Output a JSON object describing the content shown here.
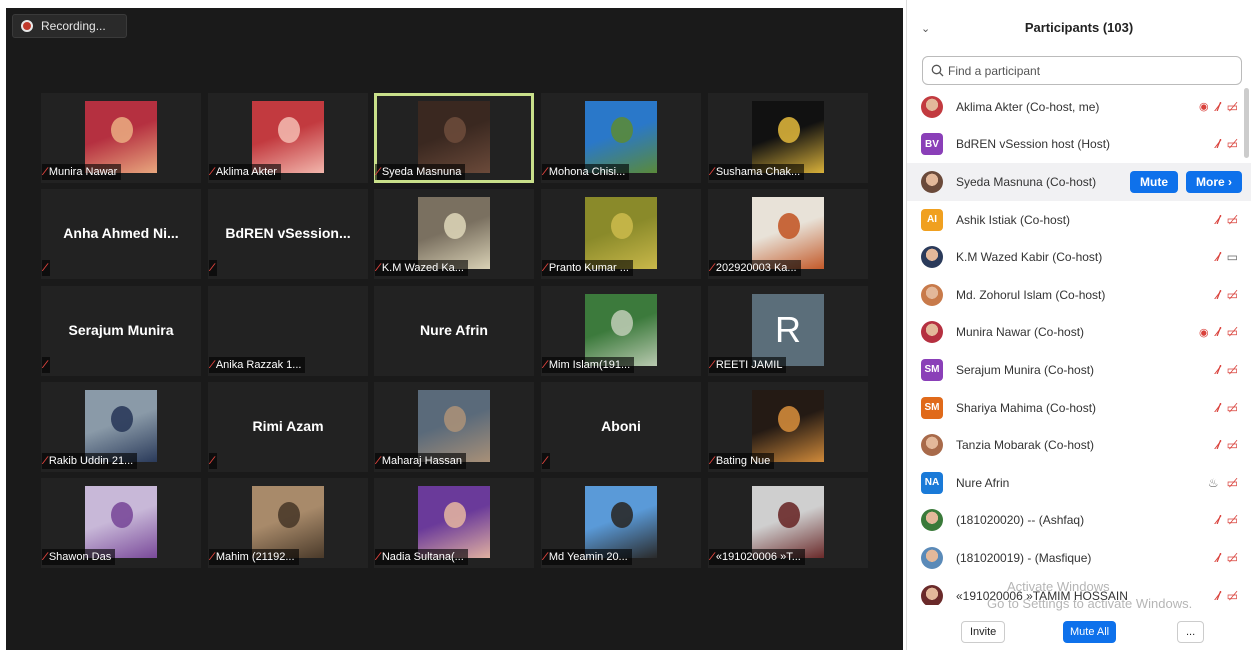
{
  "recording": {
    "label": "Recording...",
    "icon": "record-dot-icon"
  },
  "gallery": [
    {
      "name": "Munira Nawar",
      "type": "photo",
      "bg": "#b53040",
      "fg": "#e8a77e"
    },
    {
      "name": "Aklima Akter",
      "type": "photo",
      "bg": "#c23a3f",
      "fg": "#f2b6ac"
    },
    {
      "name": "Syeda Masnuna",
      "type": "photo",
      "bg": "#3a2820",
      "fg": "#6b4a3a",
      "active": true
    },
    {
      "name": "Mohona Chisi...",
      "type": "photo",
      "bg": "#2a78c9",
      "fg": "#5a8a3a"
    },
    {
      "name": "Sushama Chak...",
      "type": "photo",
      "bg": "#111111",
      "fg": "#d9b13a"
    },
    {
      "name": "",
      "display": "Anha Ahmed Ni...",
      "type": "name"
    },
    {
      "name": "",
      "display": "BdREN  vSession...",
      "type": "name"
    },
    {
      "name": "K.M Wazed Ka...",
      "type": "photo",
      "bg": "#7a7060",
      "fg": "#d9d1b5"
    },
    {
      "name": "Pranto Kumar ...",
      "type": "photo",
      "bg": "#8a8a2a",
      "fg": "#c9b84a"
    },
    {
      "name": "202920003 Ka...",
      "type": "photo",
      "bg": "#e8e2d8",
      "fg": "#c35a2a"
    },
    {
      "name": "",
      "display": "Serajum Munira",
      "type": "name"
    },
    {
      "name": "Anika Razzak 1...",
      "type": "blank"
    },
    {
      "name": "",
      "display": "Nure Afrin",
      "type": "name",
      "nomic": true
    },
    {
      "name": "Mim Islam(191...",
      "type": "photo",
      "bg": "#3c7a3c",
      "fg": "#b9c9b0"
    },
    {
      "name": "REETI JAMIL",
      "type": "letter",
      "letter": "R"
    },
    {
      "name": "Rakib Uddin 21...",
      "type": "photo",
      "bg": "#8a9aa8",
      "fg": "#2a3a5a"
    },
    {
      "name": "",
      "display": "Rimi Azam",
      "type": "name"
    },
    {
      "name": "Maharaj Hassan",
      "type": "photo",
      "bg": "#5a6a7a",
      "fg": "#a89078"
    },
    {
      "name": "",
      "display": "Aboni",
      "type": "name"
    },
    {
      "name": "Bating Nue",
      "type": "photo",
      "bg": "#241a14",
      "fg": "#d08a3a"
    },
    {
      "name": "Shawon Das",
      "type": "photo",
      "bg": "#c8b8d8",
      "fg": "#7a4a9a"
    },
    {
      "name": "Mahim (21192...",
      "type": "photo",
      "bg": "#a88a6a",
      "fg": "#4a3a2a"
    },
    {
      "name": "Nadia Sultana(...",
      "type": "photo",
      "bg": "#6a3a9a",
      "fg": "#e0b0a0"
    },
    {
      "name": "Md Yeamin 20...",
      "type": "photo",
      "bg": "#5a9ad8",
      "fg": "#2a2a2a"
    },
    {
      "name": "«191020006 »T...",
      "type": "photo",
      "bg": "#cfcfcf",
      "fg": "#6a2a2a"
    }
  ],
  "panel": {
    "title": "Participants (103)",
    "search_placeholder": "Find a participant",
    "participants": [
      {
        "name": "Aklima Akter (Co-host, me)",
        "avatar": "photo",
        "color": "#c23a3f",
        "icons": [
          "screen-share-icon",
          "mic-off-icon",
          "video-off-icon"
        ]
      },
      {
        "name": "BdREN vSession host (Host)",
        "avatar": "BV",
        "color": "#8a3fb8",
        "icons": [
          "mic-off-icon",
          "video-off-icon"
        ]
      },
      {
        "name": "Syeda Masnuna (Co-host)",
        "avatar": "photo",
        "color": "#6b4a3a",
        "highlight": true,
        "mute": "Mute",
        "more": "More ›"
      },
      {
        "name": "Ashik Istiak (Co-host)",
        "avatar": "AI",
        "color": "#f0a020",
        "icons": [
          "mic-off-icon",
          "video-off-icon"
        ]
      },
      {
        "name": "K.M Wazed Kabir (Co-host)",
        "avatar": "photo",
        "color": "#2a3a5a",
        "icons": [
          "mic-off-icon",
          "video-on-icon"
        ]
      },
      {
        "name": "Md. Zohorul Islam (Co-host)",
        "avatar": "photo",
        "color": "#c87a4a",
        "icons": [
          "mic-off-icon",
          "video-off-icon"
        ]
      },
      {
        "name": "Munira Nawar (Co-host)",
        "avatar": "photo",
        "color": "#b53040",
        "icons": [
          "screen-share-icon",
          "mic-off-icon",
          "video-off-icon"
        ]
      },
      {
        "name": "Serajum Munira (Co-host)",
        "avatar": "SM",
        "color": "#8a3fb8",
        "icons": [
          "mic-off-icon",
          "video-off-icon"
        ]
      },
      {
        "name": "Shariya Mahima (Co-host)",
        "avatar": "SM",
        "color": "#e06a1a",
        "icons": [
          "mic-off-icon",
          "video-off-icon"
        ]
      },
      {
        "name": "Tanzia Mobarak (Co-host)",
        "avatar": "photo",
        "color": "#a86a4a",
        "icons": [
          "mic-off-icon",
          "video-off-icon"
        ]
      },
      {
        "name": "Nure Afrin",
        "avatar": "NA",
        "color": "#1a7ad8",
        "icons": [
          "mic-on-icon",
          "video-off-icon"
        ]
      },
      {
        "name": "(181020020) -- (Ashfaq)",
        "avatar": "photo",
        "color": "#3a7a3a",
        "icons": [
          "mic-off-icon",
          "video-off-icon"
        ]
      },
      {
        "name": "(181020019) - (Masfique)",
        "avatar": "photo",
        "color": "#5a8ab8",
        "icons": [
          "mic-off-icon",
          "video-off-icon"
        ]
      },
      {
        "name": "«191020006 »TAMIM HOSSAIN",
        "avatar": "photo",
        "color": "#6a2a2a",
        "icons": [
          "mic-off-icon",
          "video-off-icon"
        ]
      }
    ],
    "footer": {
      "invite": "Invite",
      "mute_all": "Mute All",
      "more": "..."
    }
  },
  "watermark": {
    "line1": "Activate Windows",
    "line2": "Go to Settings to activate Windows."
  }
}
